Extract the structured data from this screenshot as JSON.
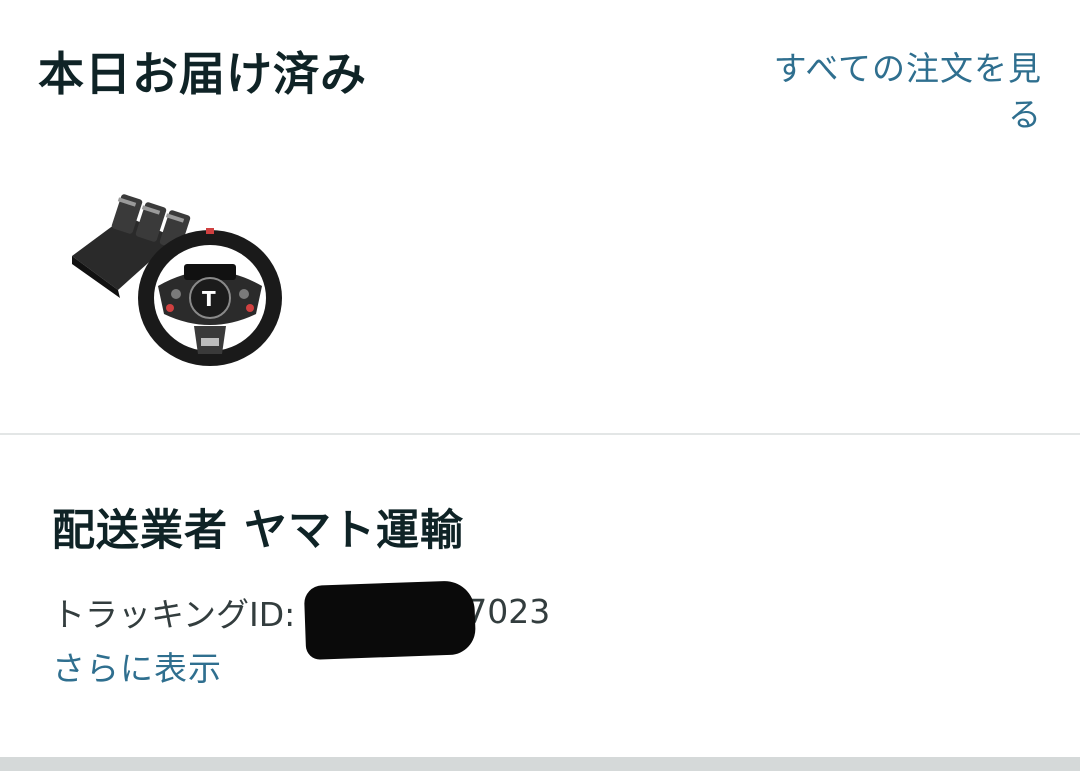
{
  "header": {
    "title": "本日お届け済み",
    "all_orders_link": "すべての注文を見る"
  },
  "product": {
    "image_icon": "racing-wheel-pedals-image"
  },
  "shipment": {
    "carrier": "配送業者 ヤマト運輸",
    "tracking_label": "トラッキングID:",
    "tracking_suffix": "37023",
    "show_more": "さらに表示"
  },
  "colors": {
    "link": "#2f6f8f",
    "title": "#0f2326",
    "divider": "#e3e6e6"
  }
}
